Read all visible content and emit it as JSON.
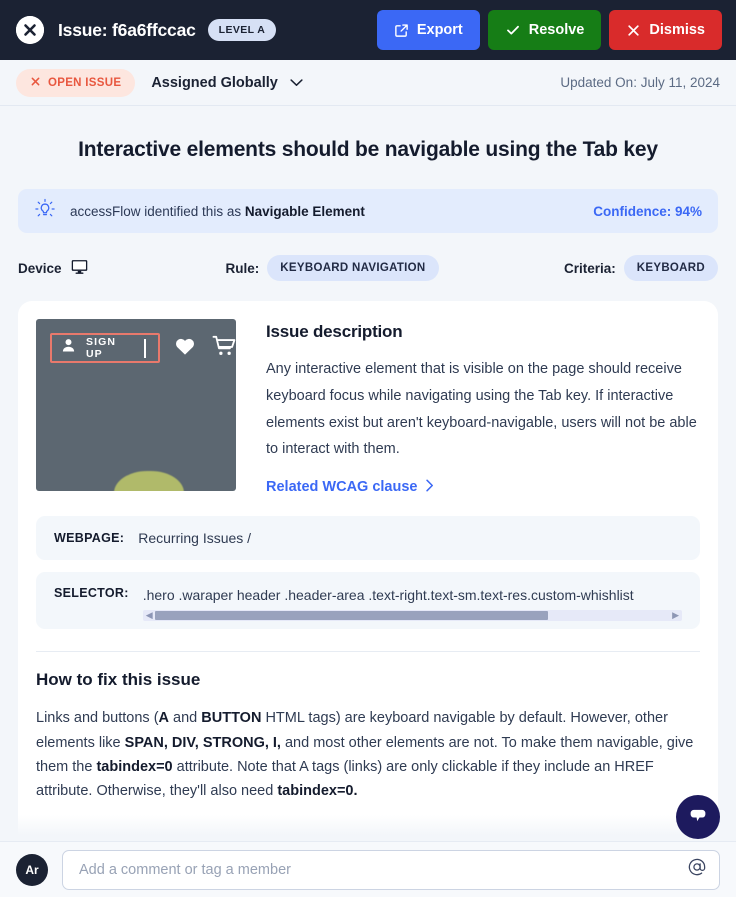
{
  "topbar": {
    "close_icon": "close-circle-icon",
    "title": "Issue: f6a6ffccac",
    "level_badge": "LEVEL A",
    "actions": [
      {
        "label": "Export",
        "icon": "external-link-icon",
        "color": "#3b68f5"
      },
      {
        "label": "Resolve",
        "icon": "check-icon",
        "color": "#167d16"
      },
      {
        "label": "Dismiss",
        "icon": "x-icon",
        "color": "#d92b2b"
      }
    ]
  },
  "subheader": {
    "status_label": "OPEN ISSUE",
    "status_icon": "x-icon",
    "status_color": "#e8573f",
    "assignment": "Assigned Globally",
    "assignment_caret": "chevron-down-icon",
    "updated": "Updated On: July 11, 2024"
  },
  "page": {
    "title": "Interactive elements should be navigable using the Tab key"
  },
  "ai_banner": {
    "icon": "lightbulb-icon",
    "text_prefix": "accessFlow identified this as ",
    "text_bold": "Navigable Element",
    "confidence": "Confidence: 94%",
    "accent": "#3b68f5"
  },
  "meta": {
    "device_label": "Device",
    "device_icon": "monitor-icon",
    "rule_label": "Rule:",
    "rule_value": "KEYBOARD NAVIGATION",
    "criteria_label": "Criteria:",
    "criteria_value": "KEYBOARD"
  },
  "thumbnail": {
    "signup_label": "SIGN UP",
    "person_icon": "person-icon",
    "heart_icon": "heart-icon",
    "cart_icon": "shopping-cart-icon",
    "highlight_color": "#e8796c"
  },
  "description": {
    "heading": "Issue description",
    "body": "Any interactive element that is visible on the page should receive keyboard focus while navigating using the Tab key. If interactive elements exist but aren't keyboard-navigable, users will not be able to interact with them.",
    "link_label": "Related WCAG clause",
    "link_icon": "chevron-right-icon"
  },
  "info": {
    "webpage_key": "WEBPAGE:",
    "webpage_value": "Recurring Issues /",
    "selector_key": "SELECTOR:",
    "selector_value": ".hero .waraper header .header-area .text-right.text-sm.text-res.custom-whishlist"
  },
  "fix": {
    "heading": "How to fix this issue",
    "p1_a": "Links and buttons (",
    "p1_b1": "A",
    "p1_c": " and ",
    "p1_b2": "BUTTON",
    "p1_d": " HTML tags) are keyboard navigable by default. However, other elements like ",
    "p1_b3": "SPAN, DIV, STRONG, I,",
    "p1_e": " and most other elements are not. To make them navigable, give them the ",
    "p1_b4": "tabindex=0",
    "p1_f": " attribute. Note that A tags (links) are only clickable if they include an HREF attribute. Otherwise, they'll also need ",
    "p1_b5": "tabindex=0."
  },
  "comment": {
    "avatar_initials": "Ar",
    "placeholder": "Add a comment or tag a member",
    "mention_icon": "at-icon"
  },
  "chat": {
    "icon": "chat-bubble-icon",
    "color": "#1d1a5e"
  }
}
